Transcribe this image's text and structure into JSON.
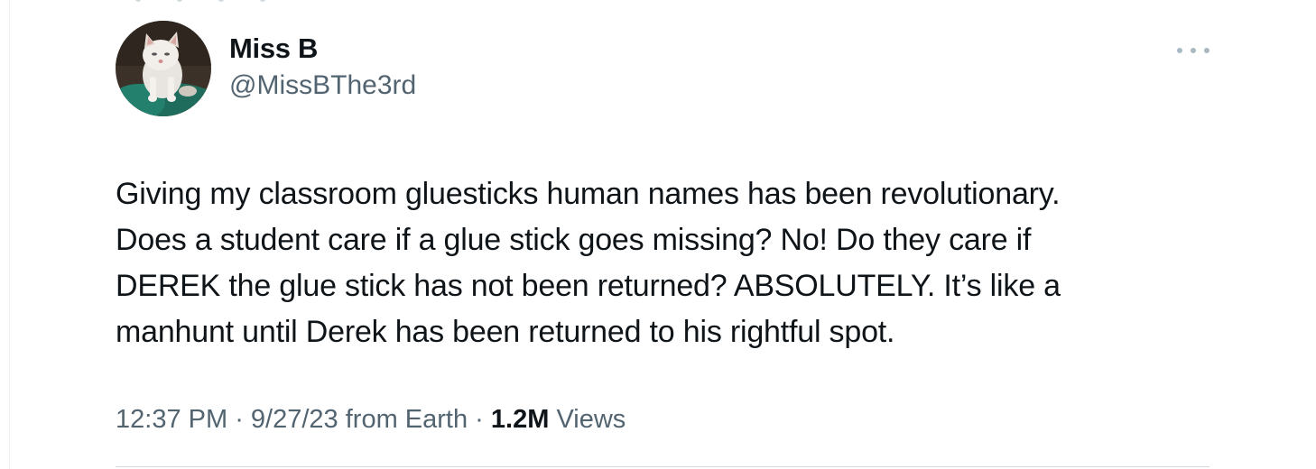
{
  "tweet": {
    "author": {
      "display_name": "Miss B",
      "handle": "@MissBThe3rd",
      "avatar_icon": "kitten-avatar"
    },
    "text_lines": [
      "Giving my classroom gluesticks human names has been revolutionary.",
      "Does a student care if a glue stick goes missing? No! Do they care if",
      "DEREK the glue stick has not been returned? ABSOLUTELY. It’s like a",
      "manhunt until Derek has been returned to his rightful spot."
    ],
    "meta": {
      "time": "12:37 PM",
      "sep1": " · ",
      "date": "9/27/23",
      "source": " from Earth",
      "sep2": " · ",
      "views_count": "1.2M",
      "views_label": " Views"
    },
    "more_icon": "more-horizontal-icon"
  },
  "colors": {
    "text_primary": "#0f1419",
    "text_secondary": "#536471",
    "divider": "#cfd9de"
  }
}
